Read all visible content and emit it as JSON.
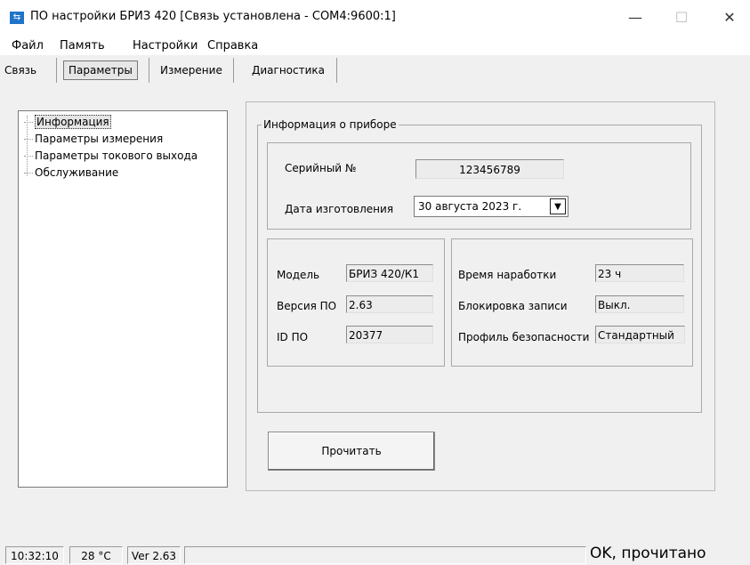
{
  "window": {
    "title": "ПО настройки БРИЗ 420 [Связь установлена - COM4:9600:1]",
    "app_icon": "app-logo-icon",
    "minimize": "—",
    "maximize": "☐",
    "close": "✕"
  },
  "menu": [
    "Файл",
    "Память",
    "Настройки",
    "Справка"
  ],
  "tabs": [
    "Связь",
    "Параметры",
    "Измерение",
    "Диагностика"
  ],
  "active_tab": "Параметры",
  "tree": [
    "Информация",
    "Параметры измерения",
    "Параметры токового выхода",
    "Обслуживание"
  ],
  "selected_tree_item": "Информация",
  "device_info": {
    "group_title": "Информация о приборе",
    "serial_label": "Серийный №",
    "serial_value": "123456789",
    "date_label": "Дата изготовления",
    "date_value": "30  августа  2023 г.",
    "model_label": "Модель",
    "model_value": "БРИЗ 420/К1",
    "version_label": "Версия ПО",
    "version_value": "2.63",
    "id_label": "ID ПО",
    "id_value": "20377",
    "runtime_label": "Время наработки",
    "runtime_value": "23 ч",
    "lock_label": "Блокировка записи",
    "lock_value": "Выкл.",
    "profile_label": "Профиль безопасности",
    "profile_value": "Стандартный"
  },
  "read_button": "Прочитать",
  "status": {
    "time": "10:32:10",
    "temp": "28 °C",
    "version": "Ver 2.63",
    "message": "OK, прочитано"
  }
}
